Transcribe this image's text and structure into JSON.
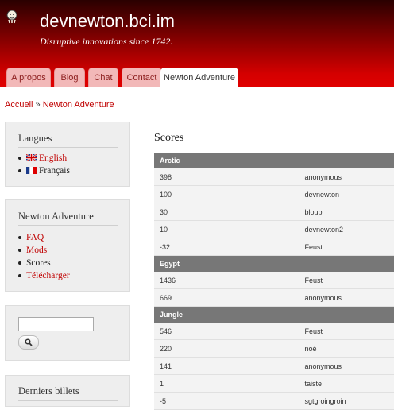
{
  "site": {
    "name": "devnewton.bci.im",
    "slogan": "Disruptive innovations since 1742."
  },
  "tabs": [
    {
      "label": "A propos",
      "active": false
    },
    {
      "label": "Blog",
      "active": false
    },
    {
      "label": "Chat",
      "active": false
    },
    {
      "label": "Contact",
      "active": false
    },
    {
      "label": "Newton Adventure",
      "active": true
    }
  ],
  "breadcrumb": {
    "home": "Accueil",
    "separator": "»",
    "current": "Newton Adventure"
  },
  "blocks": {
    "languages": {
      "title": "Langues",
      "items": [
        {
          "label": "English",
          "link": true
        },
        {
          "label": "Français",
          "link": false
        }
      ]
    },
    "newton": {
      "title": "Newton Adventure",
      "items": [
        {
          "label": "FAQ",
          "link": true
        },
        {
          "label": "Mods",
          "link": true
        },
        {
          "label": "Scores",
          "link": false
        },
        {
          "label": "Télécharger",
          "link": true
        }
      ]
    },
    "search": {
      "placeholder": ""
    },
    "latest": {
      "title": "Derniers billets"
    }
  },
  "scores": {
    "title": "Scores",
    "groups": [
      {
        "name": "Arctic",
        "rows": [
          [
            "398",
            "anonymous"
          ],
          [
            "100",
            "devnewton"
          ],
          [
            "30",
            "bloub"
          ],
          [
            "10",
            "devnewton2"
          ],
          [
            "-32",
            "Feust"
          ]
        ]
      },
      {
        "name": "Egypt",
        "rows": [
          [
            "1436",
            "Feust"
          ],
          [
            "669",
            "anonymous"
          ]
        ]
      },
      {
        "name": "Jungle",
        "rows": [
          [
            "546",
            "Feust"
          ],
          [
            "220",
            "noé"
          ],
          [
            "141",
            "anonymous"
          ],
          [
            "1",
            "taiste"
          ],
          [
            "-5",
            "sgtgroingroin"
          ]
        ]
      }
    ]
  },
  "colors": {
    "header_dark": "#2a0000",
    "header_red": "#e00000",
    "link": "#c00000",
    "table_header": "#777777"
  }
}
